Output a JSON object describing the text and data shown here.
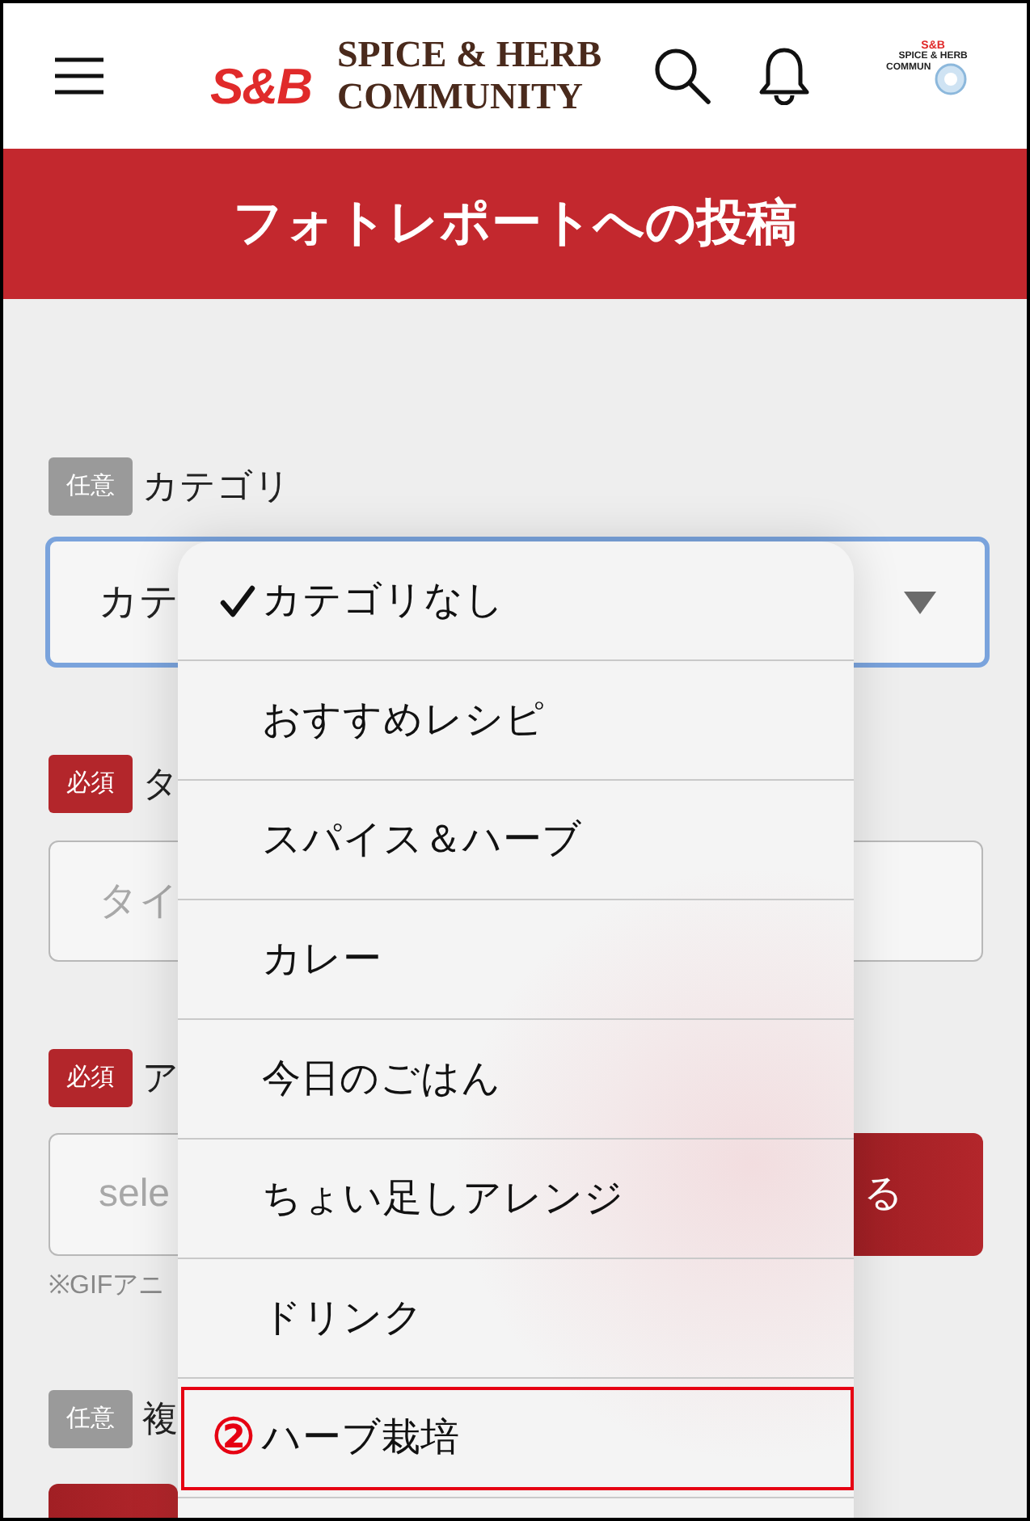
{
  "header": {
    "logo": {
      "brand": "S&B",
      "name_lines": [
        "SPICE & HERB",
        "COMMUNITY"
      ]
    },
    "profile": {
      "brand": "S&B",
      "name_lines": [
        "SPICE & HERB",
        "COMMUN"
      ]
    }
  },
  "title": "フォトレポートへの投稿",
  "form": {
    "fields": [
      {
        "kind": "select",
        "badge": {
          "text": "任意",
          "required": false
        },
        "label": "カテゴリ",
        "value": "カテ",
        "focused": true
      },
      {
        "kind": "text",
        "badge": {
          "text": "必須",
          "required": true
        },
        "label": "タ",
        "placeholder": "タイ"
      },
      {
        "kind": "file",
        "badge": {
          "text": "必須",
          "required": true
        },
        "label": "ア",
        "placeholder": "sele",
        "button": "る",
        "note": "※GIFアニ"
      },
      {
        "kind": "button",
        "badge": {
          "text": "任意",
          "required": false
        },
        "label": "複"
      }
    ]
  },
  "dropdown": {
    "items": [
      {
        "label": "カテゴリなし",
        "selected": true
      },
      {
        "label": "おすすめレシピ",
        "selected": false
      },
      {
        "label": "スパイス＆ハーブ",
        "selected": false
      },
      {
        "label": "カレー",
        "selected": false
      },
      {
        "label": "今日のごはん",
        "selected": false
      },
      {
        "label": "ちょい足しアレンジ",
        "selected": false
      },
      {
        "label": "ドリンク",
        "selected": false
      },
      {
        "label": "ハーブ栽培",
        "selected": false,
        "callout": "②"
      }
    ]
  }
}
